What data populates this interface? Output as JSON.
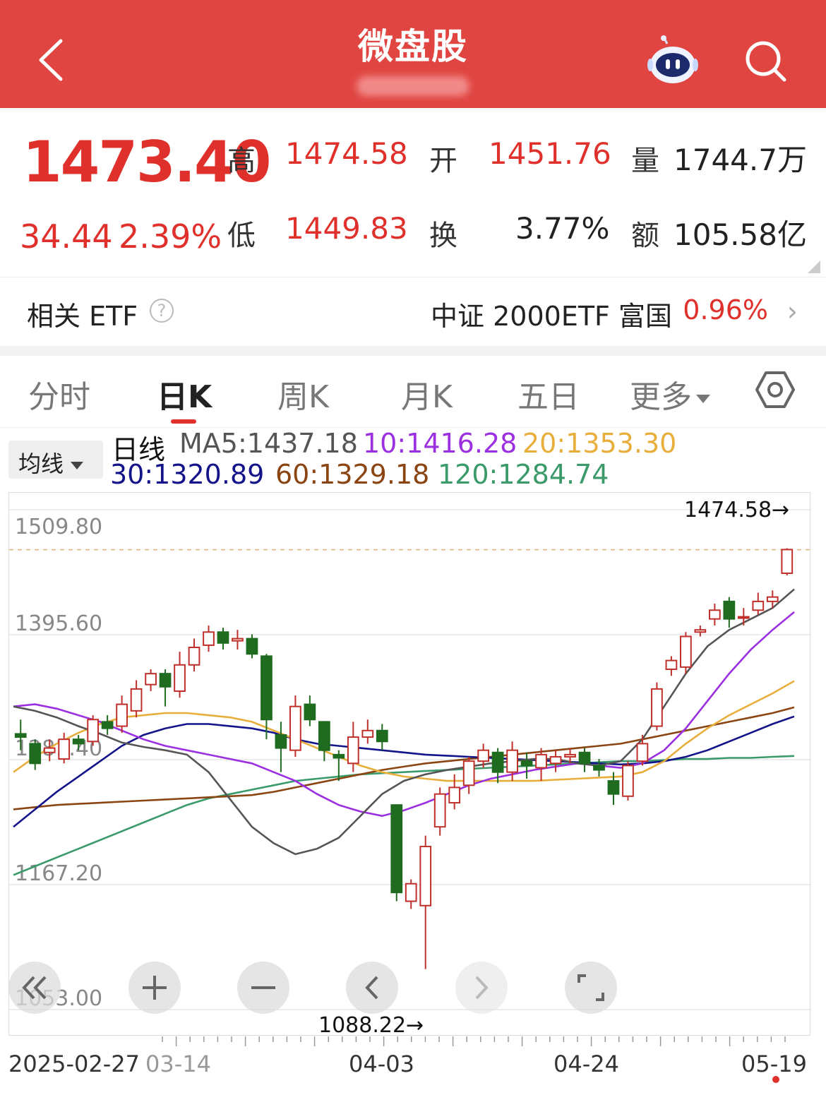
{
  "header": {
    "title": "微盘股",
    "back_icon": "chevron-left-icon",
    "assistant_icon": "robot-icon",
    "search_icon": "search-icon"
  },
  "quote": {
    "price": "1473.40",
    "change": "34.44",
    "change_pct": "2.39%",
    "high_label": "高",
    "high": "1474.58",
    "low_label": "低",
    "low": "1449.83",
    "open_label": "开",
    "open": "1451.76",
    "turnover_label": "换",
    "turnover": "3.77%",
    "volume_label": "量",
    "volume": "1744.7万",
    "amount_label": "额",
    "amount": "105.58亿"
  },
  "etf": {
    "label": "相关 ETF",
    "help_icon": "?",
    "name": "中证 2000ETF 富国",
    "pct": "0.96%",
    "arrow": "›"
  },
  "tabs": [
    {
      "label": "分时",
      "active": false
    },
    {
      "label": "日K",
      "active": true
    },
    {
      "label": "周K",
      "active": false
    },
    {
      "label": "月K",
      "active": false
    },
    {
      "label": "五日",
      "active": false
    },
    {
      "label": "更多",
      "active": false
    }
  ],
  "ma": {
    "selector": "均线",
    "line_label": "日线",
    "ma5": "MA5:1437.18",
    "ma10": "10:1416.28",
    "ma20": "20:1353.30",
    "ma30": "30:1320.89",
    "ma60": "60:1329.18",
    "ma120": "120:1284.74",
    "colors": {
      "ma5": "#555555",
      "ma10": "#9b30e0",
      "ma20": "#e8ae3c",
      "ma30": "#14148a",
      "ma60": "#8b4513",
      "ma120": "#3a9a6a",
      "up": "#c0302b",
      "down": "#1f6b1f"
    }
  },
  "chart_data": {
    "type": "candlestick",
    "y_ticks": [
      "1509.80",
      "1395.60",
      "1281.40",
      "1167.20",
      "1053.00"
    ],
    "ylim": [
      1053.0,
      1509.8
    ],
    "high_marker": "1474.58→",
    "low_marker": "1088.22→",
    "x_labels": [
      "2025-02-27",
      "03-14",
      "04-03",
      "04-24",
      "05-19"
    ],
    "candles": [
      [
        1305,
        1302,
        1318,
        1290
      ],
      [
        1296,
        1278,
        1300,
        1272
      ],
      [
        1288,
        1292,
        1300,
        1280
      ],
      [
        1282,
        1300,
        1306,
        1278
      ],
      [
        1300,
        1296,
        1304,
        1290
      ],
      [
        1298,
        1318,
        1322,
        1294
      ],
      [
        1316,
        1310,
        1322,
        1304
      ],
      [
        1312,
        1332,
        1340,
        1306
      ],
      [
        1326,
        1346,
        1354,
        1320
      ],
      [
        1350,
        1360,
        1364,
        1344
      ],
      [
        1360,
        1348,
        1364,
        1330
      ],
      [
        1344,
        1368,
        1380,
        1338
      ],
      [
        1368,
        1384,
        1392,
        1362
      ],
      [
        1386,
        1398,
        1404,
        1380
      ],
      [
        1398,
        1388,
        1402,
        1382
      ],
      [
        1390,
        1392,
        1400,
        1382
      ],
      [
        1392,
        1378,
        1396,
        1374
      ],
      [
        1376,
        1318,
        1378,
        1300
      ],
      [
        1304,
        1292,
        1316,
        1270
      ],
      [
        1290,
        1330,
        1340,
        1284
      ],
      [
        1332,
        1318,
        1340,
        1312
      ],
      [
        1316,
        1290,
        1316,
        1280
      ],
      [
        1286,
        1283,
        1290,
        1262
      ],
      [
        1278,
        1302,
        1316,
        1270
      ],
      [
        1302,
        1308,
        1318,
        1296
      ],
      [
        1308,
        1298,
        1314,
        1290
      ],
      [
        1240,
        1160,
        1240,
        1152
      ],
      [
        1152,
        1168,
        1172,
        1145
      ],
      [
        1148,
        1202,
        1212,
        1090
      ],
      [
        1220,
        1250,
        1256,
        1212
      ],
      [
        1242,
        1256,
        1268,
        1236
      ],
      [
        1258,
        1280,
        1284,
        1250
      ],
      [
        1280,
        1290,
        1296,
        1274
      ],
      [
        1288,
        1270,
        1292,
        1260
      ],
      [
        1270,
        1290,
        1298,
        1262
      ],
      [
        1280,
        1276,
        1288,
        1264
      ],
      [
        1274,
        1286,
        1292,
        1262
      ],
      [
        1278,
        1284,
        1290,
        1270
      ],
      [
        1284,
        1286,
        1292,
        1278
      ],
      [
        1288,
        1278,
        1292,
        1270
      ],
      [
        1276,
        1272,
        1282,
        1266
      ],
      [
        1262,
        1250,
        1270,
        1240
      ],
      [
        1248,
        1276,
        1280,
        1244
      ],
      [
        1280,
        1296,
        1304,
        1276
      ],
      [
        1312,
        1346,
        1352,
        1308
      ],
      [
        1364,
        1372,
        1376,
        1358
      ],
      [
        1366,
        1394,
        1398,
        1360
      ],
      [
        1398,
        1400,
        1404,
        1394
      ],
      [
        1410,
        1418,
        1424,
        1404
      ],
      [
        1426,
        1410,
        1430,
        1402
      ],
      [
        1412,
        1412,
        1420,
        1404
      ],
      [
        1418,
        1426,
        1434,
        1414
      ],
      [
        1426,
        1430,
        1436,
        1420
      ],
      [
        1451.76,
        1473.4,
        1474.58,
        1449.83
      ]
    ],
    "ma": {
      "ma5": [
        1330,
        1326,
        1320,
        1312,
        1305,
        1297,
        1293,
        1290,
        1286,
        1270,
        1245,
        1220,
        1205,
        1195,
        1200,
        1210,
        1230,
        1250,
        1262,
        1268,
        1272,
        1275,
        1278,
        1280,
        1282,
        1282,
        1278,
        1276,
        1280,
        1300,
        1330,
        1360,
        1385,
        1400,
        1410,
        1420,
        1437.18
      ],
      "ma10": [
        1330,
        1332,
        1328,
        1322,
        1316,
        1308,
        1300,
        1294,
        1290,
        1286,
        1282,
        1278,
        1270,
        1262,
        1250,
        1240,
        1234,
        1230,
        1235,
        1242,
        1250,
        1258,
        1264,
        1268,
        1272,
        1275,
        1278,
        1276,
        1274,
        1278,
        1290,
        1310,
        1335,
        1360,
        1382,
        1400,
        1416.28
      ],
      "ma20": [
        1270,
        1284,
        1296,
        1306,
        1314,
        1320,
        1322,
        1324,
        1324,
        1322,
        1320,
        1316,
        1308,
        1300,
        1292,
        1284,
        1276,
        1270,
        1266,
        1264,
        1262,
        1262,
        1262,
        1262,
        1262,
        1263,
        1264,
        1265,
        1266,
        1270,
        1280,
        1296,
        1310,
        1322,
        1332,
        1342,
        1353.3
      ],
      "ma30": [
        1220,
        1236,
        1252,
        1266,
        1280,
        1294,
        1304,
        1310,
        1314,
        1314,
        1312,
        1310,
        1306,
        1300,
        1296,
        1294,
        1292,
        1290,
        1288,
        1286,
        1285,
        1284,
        1283,
        1282,
        1281,
        1280,
        1279,
        1278,
        1277,
        1278,
        1280,
        1284,
        1290,
        1298,
        1306,
        1314,
        1320.89
      ],
      "ma60": [
        1236,
        1238,
        1240,
        1241,
        1242,
        1243,
        1244,
        1245,
        1246,
        1247,
        1248,
        1249,
        1252,
        1256,
        1260,
        1264,
        1268,
        1272,
        1275,
        1278,
        1280,
        1282,
        1284,
        1286,
        1288,
        1290,
        1292,
        1294,
        1296,
        1300,
        1304,
        1308,
        1312,
        1316,
        1320,
        1324,
        1329.18
      ],
      "ma120": [
        1176,
        1184,
        1192,
        1200,
        1208,
        1216,
        1224,
        1232,
        1240,
        1246,
        1250,
        1254,
        1258,
        1262,
        1264,
        1266,
        1268,
        1269,
        1270,
        1271,
        1272,
        1273,
        1274,
        1275,
        1276,
        1277,
        1278,
        1279,
        1280,
        1280,
        1281,
        1282,
        1282,
        1283,
        1283,
        1284,
        1284.74
      ]
    }
  }
}
